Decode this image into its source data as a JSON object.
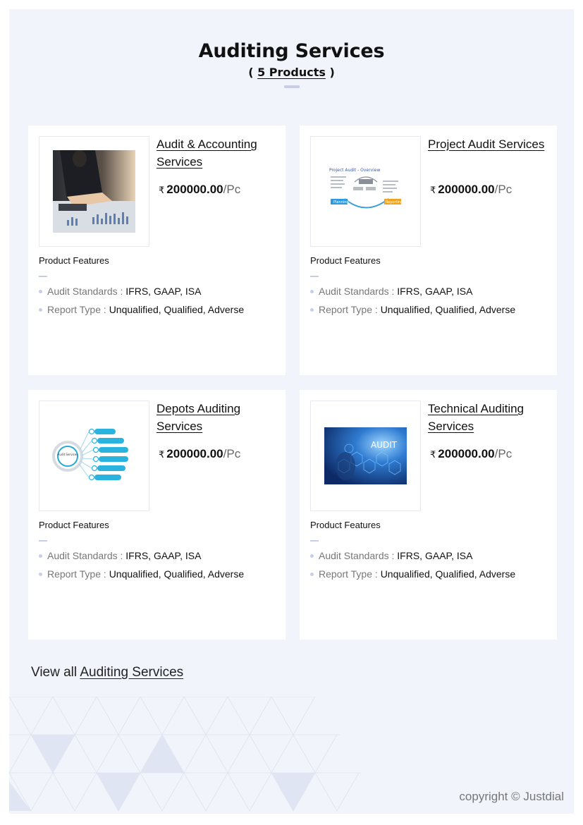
{
  "header": {
    "title": "Auditing Services",
    "count_open": "( ",
    "count_link": "5 Products",
    "count_close": " )"
  },
  "products": [
    {
      "name": "Audit & Accounting Services",
      "currency": "₹",
      "price": "200000.00",
      "unit": "/Pc",
      "features_label": "Product Features",
      "specs": [
        {
          "key": "Audit Standards :",
          "value": "IFRS, GAAP, ISA"
        },
        {
          "key": "Report Type :",
          "value": "Unqualified, Qualified, Adverse"
        }
      ],
      "image": "accounting-photo"
    },
    {
      "name": "Project Audit Services",
      "currency": "₹",
      "price": "200000.00",
      "unit": "/Pc",
      "features_label": "Product Features",
      "specs": [
        {
          "key": "Audit Standards :",
          "value": "IFRS, GAAP, ISA"
        },
        {
          "key": "Report Type :",
          "value": "Unqualified, Qualified, Adverse"
        }
      ],
      "image": "project-audit-diagram",
      "image_caption": "Project Audit - Overview",
      "image_labels": [
        "Planning",
        "Reporting"
      ]
    },
    {
      "name": "Depots Auditing Services",
      "currency": "₹",
      "price": "200000.00",
      "unit": "/Pc",
      "features_label": "Product Features",
      "specs": [
        {
          "key": "Audit Standards :",
          "value": "IFRS, GAAP, ISA"
        },
        {
          "key": "Report Type :",
          "value": "Unqualified, Qualified, Adverse"
        }
      ],
      "image": "audit-services-infographic",
      "image_center_label": "Audit Services"
    },
    {
      "name": "Technical Auditing Services",
      "currency": "₹",
      "price": "200000.00",
      "unit": "/Pc",
      "features_label": "Product Features",
      "specs": [
        {
          "key": "Audit Standards :",
          "value": "IFRS, GAAP, ISA"
        },
        {
          "key": "Report Type :",
          "value": "Unqualified, Qualified, Adverse"
        }
      ],
      "image": "audit-tech-photo",
      "image_text": "AUDIT"
    }
  ],
  "footer": {
    "view_all_prefix": "View all ",
    "view_all_link": "Auditing Services",
    "copyright": "copyright © Justdial"
  },
  "colors": {
    "page_bg": "#f1f5fb",
    "card_bg": "#ffffff",
    "accent_bar": "#c7cfe8",
    "text": "#111111",
    "muted": "#777777"
  }
}
